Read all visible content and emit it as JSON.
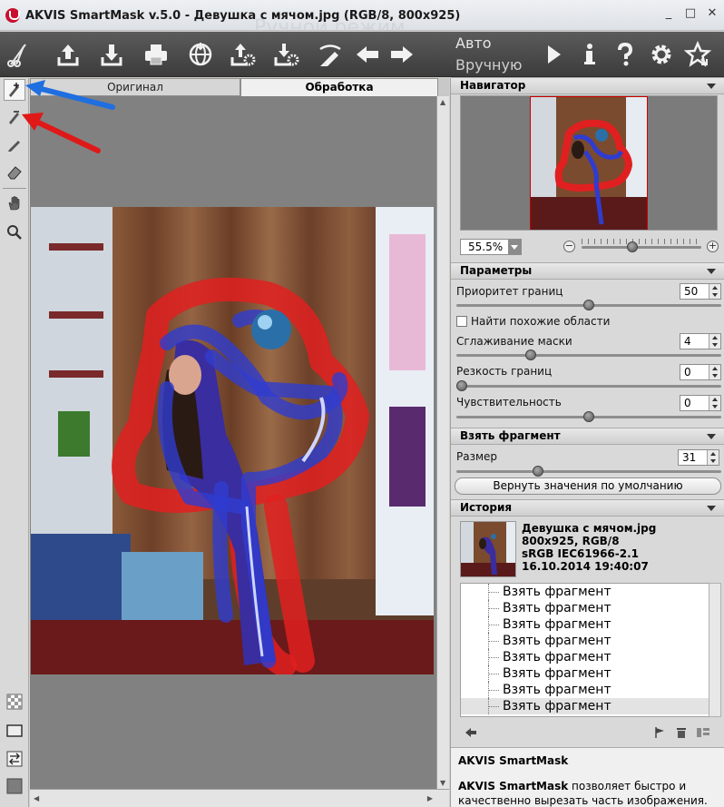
{
  "window": {
    "title": "AKVIS SmartMask v.5.0 - Девушка с мячом.jpg (RGB/8, 800x925)",
    "ghost_title": "Ручной режим",
    "minimize": "_",
    "maximize": "□",
    "close": "✕"
  },
  "toolbar": {
    "mode_auto": "Авто",
    "mode_manual": "Вручную",
    "icons": [
      "scissors-icon",
      "open-icon",
      "save-icon",
      "print-icon",
      "globe-icon",
      "export-settings-icon",
      "import-settings-icon",
      "brush-erase-icon",
      "back-arrow-icon",
      "forward-arrow-icon",
      "run-icon",
      "info-icon",
      "help-icon",
      "settings-icon",
      "favorites-icon"
    ]
  },
  "tabs": {
    "original": "Оригинал",
    "processing": "Обработка"
  },
  "navigator": {
    "title": "Навигатор",
    "zoom": "55.5%",
    "zoom_minus": "−",
    "zoom_plus": "+",
    "zoom_level": 0.42
  },
  "params": {
    "title": "Параметры",
    "border_priority_label": "Приоритет границ",
    "border_priority": "50",
    "border_priority_level": 0.5,
    "find_similar_label": "Найти похожие области",
    "mask_smoothing_label": "Сглаживание маски",
    "mask_smoothing": "4",
    "mask_smoothing_level": 0.27,
    "edge_sharpness_label": "Резкость границ",
    "edge_sharpness": "0",
    "edge_sharpness_level": 0.0,
    "sensitivity_label": "Чувствительность",
    "sensitivity": "0",
    "sensitivity_level": 0.5
  },
  "fragment": {
    "title": "Взять фрагмент",
    "size_label": "Размер",
    "size": "31",
    "size_level": 0.3,
    "reset_button": "Вернуть значения по умолчанию"
  },
  "history": {
    "title": "История",
    "file_name": "Девушка с мячом.jpg",
    "dims": "800x925, RGB/8",
    "profile": "sRGB IEC61966-2.1",
    "date": "16.10.2014 19:40:07",
    "items": [
      "Взять фрагмент",
      "Взять фрагмент",
      "Взять фрагмент",
      "Взять фрагмент",
      "Взять фрагмент",
      "Взять фрагмент",
      "Взять фрагмент",
      "Взять фрагмент"
    ]
  },
  "help": {
    "title": "AKVIS SmartMask",
    "brand": "AKVIS SmartMask",
    "line1": " позволяет быстро и",
    "line2": "качественно вырезать часть изображения."
  },
  "colors": {
    "mask_red": "#e02020",
    "mask_blue": "#2f3ccf",
    "arrow_blue": "#1f6fe0",
    "arrow_red": "#e01818"
  }
}
